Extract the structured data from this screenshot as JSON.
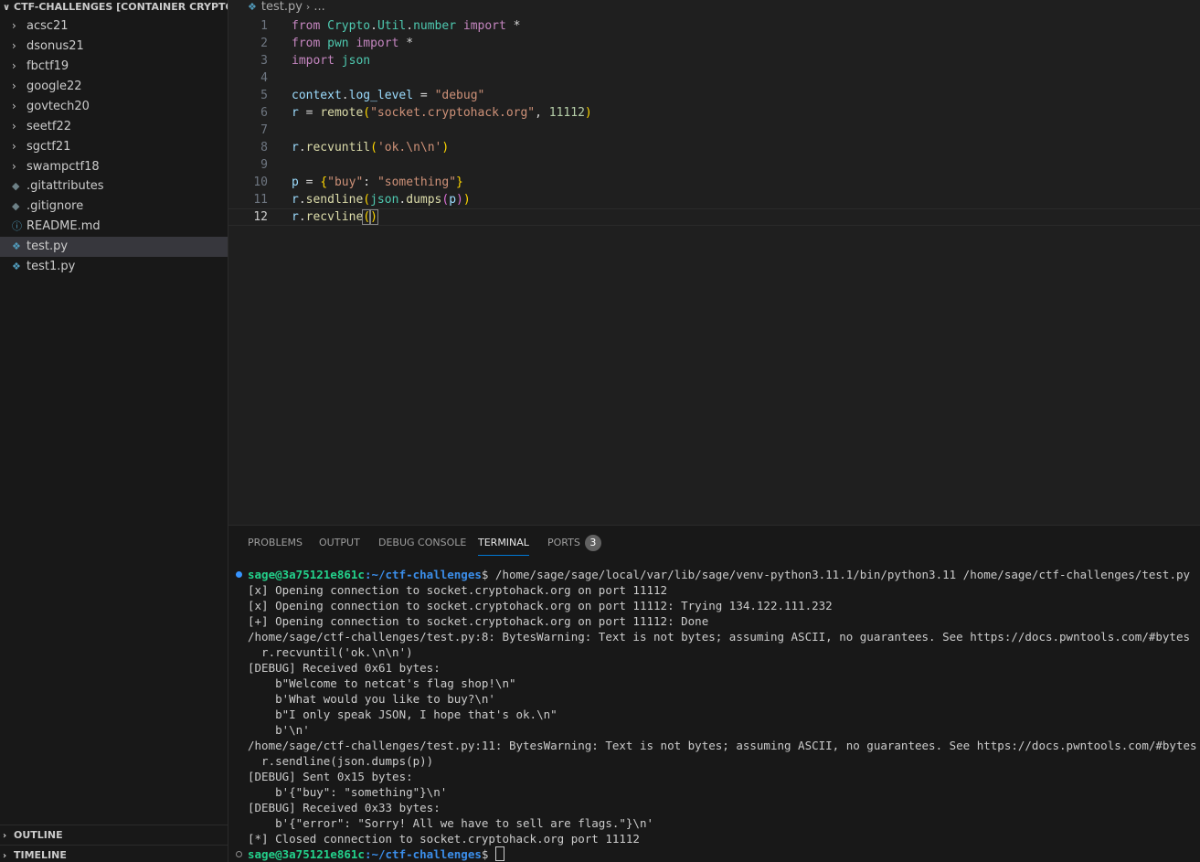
{
  "sidebar": {
    "title": "CTF-CHALLENGES [CONTAINER CRYPTOHA...",
    "items": [
      {
        "label": "acsc21",
        "type": "folder"
      },
      {
        "label": "dsonus21",
        "type": "folder"
      },
      {
        "label": "fbctf19",
        "type": "folder"
      },
      {
        "label": "google22",
        "type": "folder"
      },
      {
        "label": "govtech20",
        "type": "folder"
      },
      {
        "label": "seetf22",
        "type": "folder"
      },
      {
        "label": "sgctf21",
        "type": "folder"
      },
      {
        "label": "swampctf18",
        "type": "folder"
      },
      {
        "label": ".gitattributes",
        "type": "git-file",
        "icon": "git-icon"
      },
      {
        "label": ".gitignore",
        "type": "git-file",
        "icon": "git-icon"
      },
      {
        "label": "README.md",
        "type": "info-file",
        "icon": "info-icon"
      },
      {
        "label": "test.py",
        "type": "python-file",
        "icon": "python-icon",
        "active": true
      },
      {
        "label": "test1.py",
        "type": "python-file",
        "icon": "python-icon"
      }
    ],
    "outline_label": "OUTLINE",
    "timeline_label": "TIMELINE"
  },
  "breadcrumb": {
    "file": "test.py",
    "rest": "..."
  },
  "editor": {
    "line_numbers": [
      "1",
      "2",
      "3",
      "4",
      "5",
      "6",
      "7",
      "8",
      "9",
      "10",
      "11",
      "12"
    ],
    "current_line": 12
  },
  "panel": {
    "tabs": {
      "problems": "PROBLEMS",
      "output": "OUTPUT",
      "debug_console": "DEBUG CONSOLE",
      "terminal": "TERMINAL",
      "ports": "PORTS",
      "ports_count": "3"
    },
    "terminal": {
      "prompt_user": "sage@3a75121e861c",
      "prompt_path": ":~/ctf-challenges",
      "command": "$ /home/sage/sage/local/var/lib/sage/venv-python3.11.1/bin/python3.11 /home/sage/ctf-challenges/test.py",
      "lines": [
        "[x] Opening connection to socket.cryptohack.org on port 11112",
        "[x] Opening connection to socket.cryptohack.org on port 11112: Trying 134.122.111.232",
        "[+] Opening connection to socket.cryptohack.org on port 11112: Done",
        "/home/sage/ctf-challenges/test.py:8: BytesWarning: Text is not bytes; assuming ASCII, no guarantees. See https://docs.pwntools.com/#bytes",
        "  r.recvuntil('ok.\\n\\n')",
        "[DEBUG] Received 0x61 bytes:",
        "    b\"Welcome to netcat's flag shop!\\n\"",
        "    b'What would you like to buy?\\n'",
        "    b\"I only speak JSON, I hope that's ok.\\n\"",
        "    b'\\n'",
        "/home/sage/ctf-challenges/test.py:11: BytesWarning: Text is not bytes; assuming ASCII, no guarantees. See https://docs.pwntools.com/#bytes",
        "  r.sendline(json.dumps(p))",
        "[DEBUG] Sent 0x15 bytes:",
        "    b'{\"buy\": \"something\"}\\n'",
        "[DEBUG] Received 0x33 bytes:",
        "    b'{\"error\": \"Sorry! All we have to sell are flags.\"}\\n'",
        "[*] Closed connection to socket.cryptohack.org port 11112"
      ],
      "final_prompt_suffix": "$ "
    }
  }
}
